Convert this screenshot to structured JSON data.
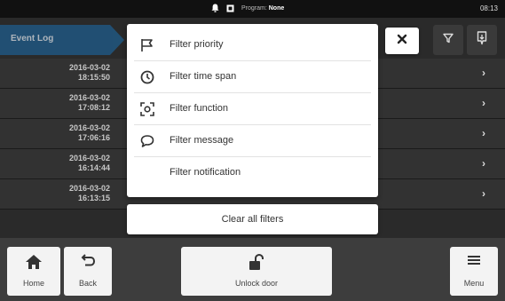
{
  "status": {
    "program_label": "Program:",
    "program_value": "None",
    "time": "08:13"
  },
  "header": {
    "tab_title": "Event Log"
  },
  "event_rows": [
    {
      "date": "2016-03-02",
      "time": "18:15:50"
    },
    {
      "date": "2016-03-02",
      "time": "17:08:12"
    },
    {
      "date": "2016-03-02",
      "time": "17:06:16"
    },
    {
      "date": "2016-03-02",
      "time": "16:14:44"
    },
    {
      "date": "2016-03-02",
      "time": "16:13:15"
    }
  ],
  "filter_menu": {
    "items": [
      {
        "label": "Filter priority",
        "icon": "flag-icon"
      },
      {
        "label": "Filter time span",
        "icon": "clock-icon"
      },
      {
        "label": "Filter function",
        "icon": "function-icon"
      },
      {
        "label": "Filter message",
        "icon": "message-icon"
      },
      {
        "label": "Filter notification",
        "icon": ""
      }
    ],
    "clear_label": "Clear all filters"
  },
  "bottom_nav": {
    "home_label": "Home",
    "back_label": "Back",
    "unlock_label": "Unlock door",
    "menu_label": "Menu"
  },
  "colors": {
    "accent": "#1f5d8c",
    "background": "#2a2a2a",
    "panel": "#ffffff"
  }
}
